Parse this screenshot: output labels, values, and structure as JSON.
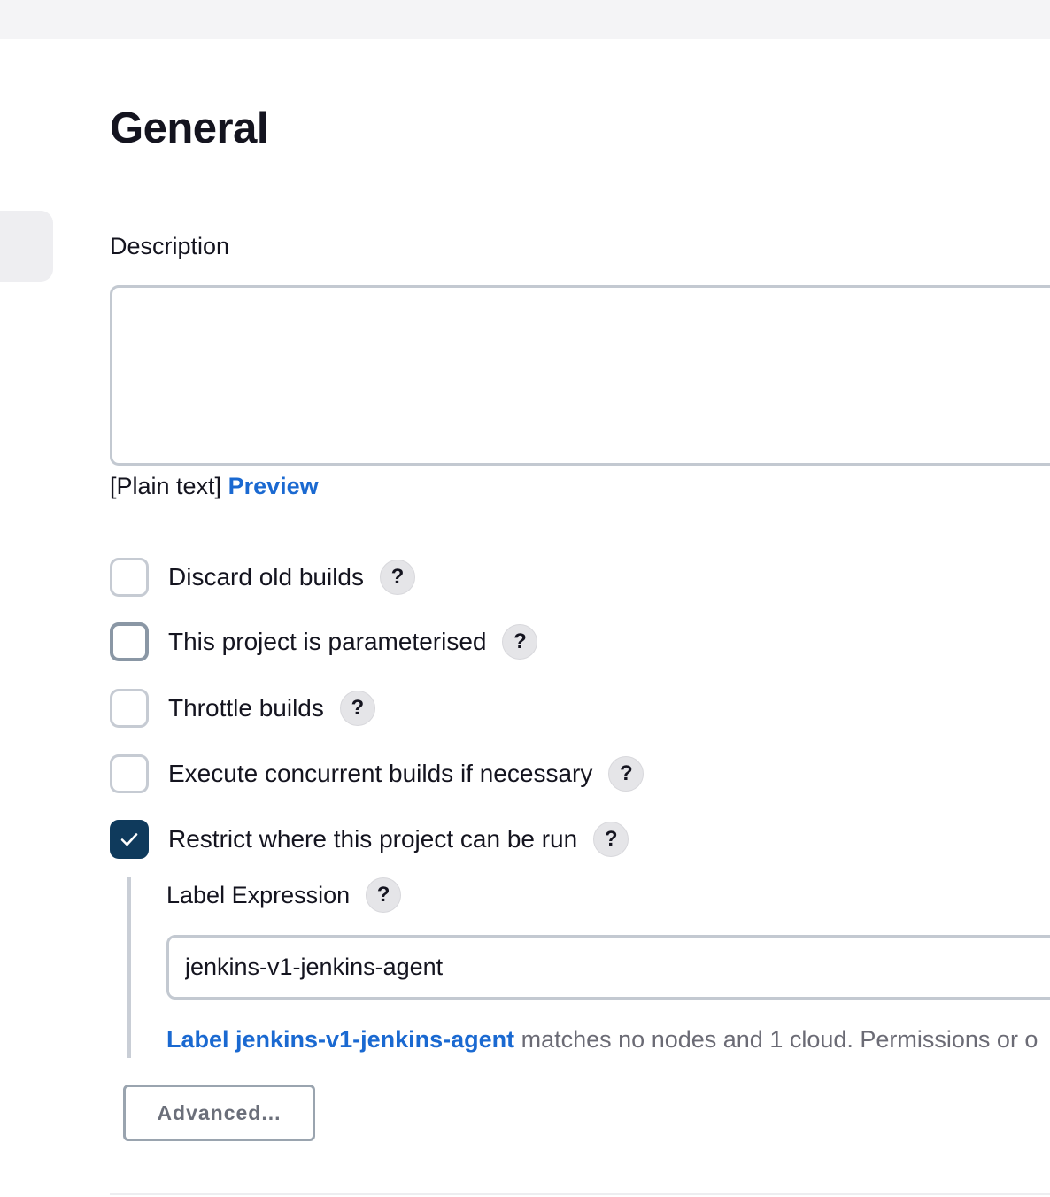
{
  "section": {
    "title": "General"
  },
  "description": {
    "label": "Description",
    "value": "",
    "format_text": "[Plain text]",
    "preview_link": "Preview"
  },
  "options": [
    {
      "label": "Discard old builds",
      "checked": false,
      "help": "?"
    },
    {
      "label": "This project is parameterised",
      "checked": false,
      "focused": true,
      "help": "?"
    },
    {
      "label": "Throttle builds",
      "checked": false,
      "help": "?"
    },
    {
      "label": "Execute concurrent builds if necessary",
      "checked": false,
      "help": "?"
    },
    {
      "label": "Restrict where this project can be run",
      "checked": true,
      "help": "?"
    }
  ],
  "label_expression": {
    "label": "Label Expression",
    "help": "?",
    "value": "jenkins-v1-jenkins-agent",
    "match_link": "Label jenkins-v1-jenkins-agent",
    "match_text": "matches no nodes and 1 cloud. Permissions or o"
  },
  "advanced_button": "Advanced...",
  "colors": {
    "accent": "#1a69d1",
    "checkbox_checked": "#0f3a5c",
    "border": "#c3c9d1"
  }
}
